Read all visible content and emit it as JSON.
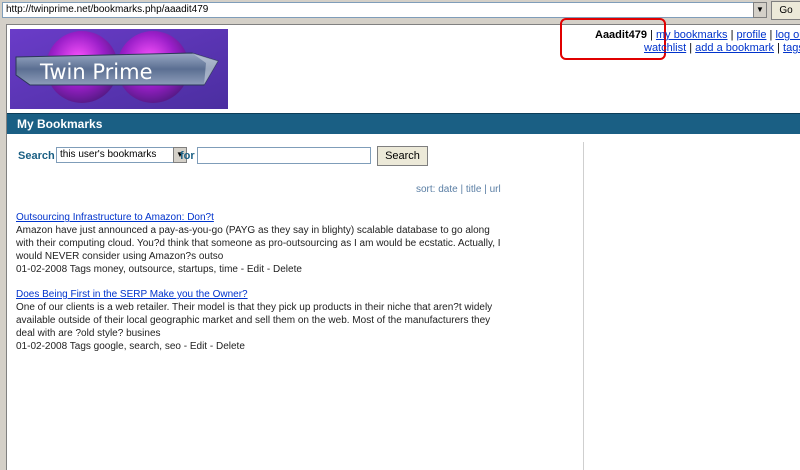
{
  "browser": {
    "url": "http://twinprime.net/bookmarks.php/aaadit479",
    "go_label": "Go"
  },
  "logo": {
    "text": "Twin Prime"
  },
  "userbar": {
    "username": "Aaadit479",
    "links": [
      "my bookmarks",
      "profile",
      "log out"
    ],
    "links2": [
      "watchlist",
      "add a bookmark",
      "tags"
    ]
  },
  "page_title": "My Bookmarks",
  "search": {
    "label": "Search",
    "scope": "this user's bookmarks",
    "for_label": "for",
    "value": "",
    "button": "Search"
  },
  "sort": {
    "label": "sort:",
    "options": [
      "date",
      "title",
      "url"
    ]
  },
  "bookmarks": [
    {
      "title": "Outsourcing Infrastructure to Amazon: Don?t",
      "description_lines": [
        "Amazon have just announced a pay-as-you-go (PAYG as they say in blighty) scalable database to go along",
        "with their computing cloud. You?d think that someone as pro-outsourcing as I am would be ecstatic. Actually, I",
        "would NEVER consider using Amazon?s outso"
      ],
      "date": "01-02-2008",
      "tags_label": "Tags",
      "tags": "money, outsource, startups, time",
      "edit": "Edit",
      "delete": "Delete"
    },
    {
      "title": "Does Being First in the SERP Make you the Owner?",
      "description_lines": [
        "One of our clients is a web retailer. Their model is that they pick up products in their niche that aren?t widely",
        "available outside of their local geographic market and sell them on the web. Most of the manufacturers they",
        "deal with are ?old style? busines"
      ],
      "date": "01-02-2008",
      "tags_label": "Tags",
      "tags": "google, search, seo",
      "edit": "Edit",
      "delete": "Delete"
    }
  ],
  "colors": {
    "title_bar": "#1a5f84",
    "link": "#0033cc",
    "highlight": "#e00000"
  }
}
